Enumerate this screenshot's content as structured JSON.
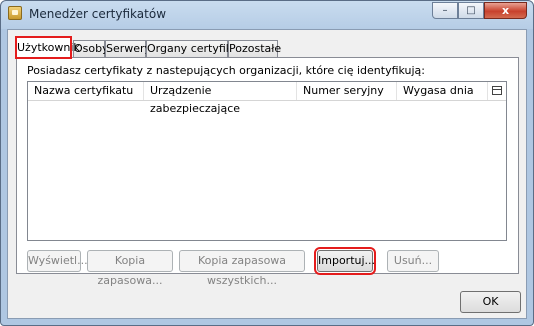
{
  "window": {
    "title": "Menedżer certyfikatów",
    "controls": {
      "minimize": "–",
      "maximize": "□",
      "close": "x"
    }
  },
  "tabs": [
    {
      "label": "Użytkownik",
      "active": true
    },
    {
      "label": "Osoby",
      "active": false
    },
    {
      "label": "Serwery",
      "active": false
    },
    {
      "label": "Organy certyfikacji",
      "active": false
    },
    {
      "label": "Pozostałe",
      "active": false
    }
  ],
  "panel": {
    "description": "Posiadasz certyfikaty z nastepujących organizacji, które cię identyfikują:",
    "columns": [
      "Nazwa certyfikatu",
      "Urządzenie zabezpieczające",
      "Numer seryjny",
      "Wygasa dnia"
    ],
    "rows": []
  },
  "buttons": {
    "view": "Wyświetl...",
    "backup": "Kopia zapasowa...",
    "backup_all": "Kopia zapasowa wszystkich...",
    "import": "Importuj...",
    "delete": "Usuń..."
  },
  "footer": {
    "ok": "OK"
  },
  "colors": {
    "highlight": "#e41c1c",
    "disabled_text": "#838383"
  }
}
